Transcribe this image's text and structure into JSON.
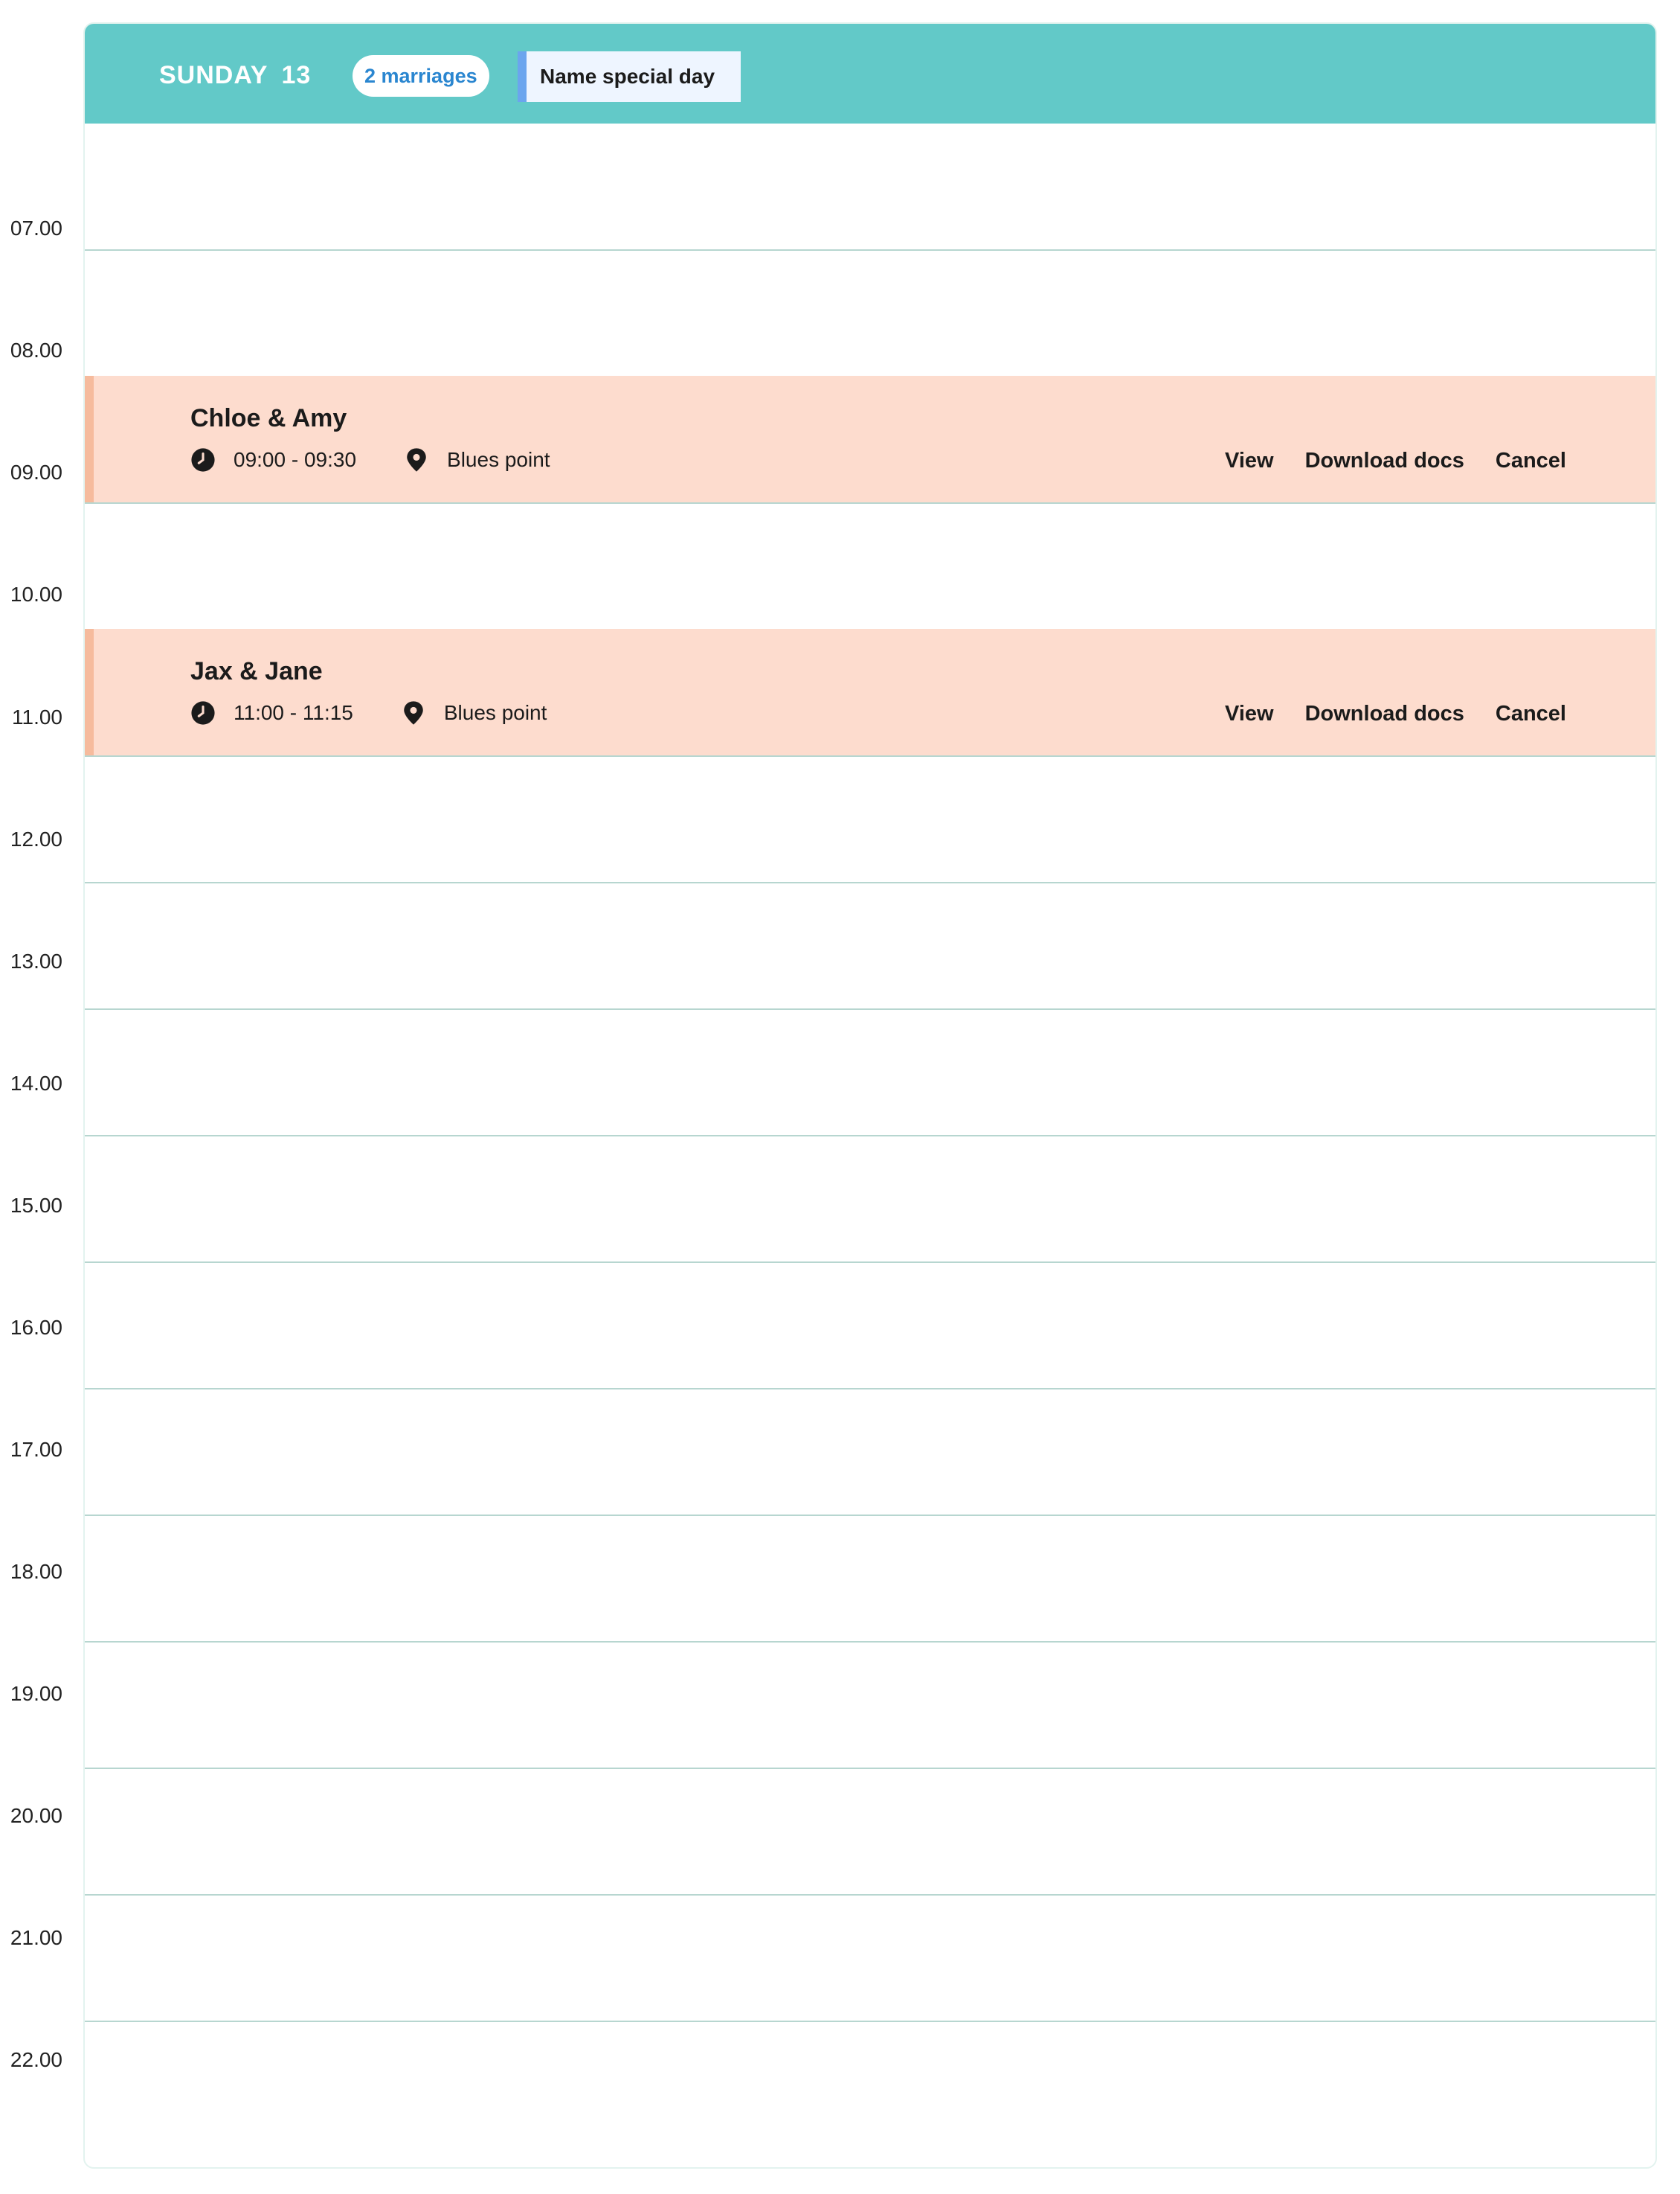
{
  "header": {
    "day": "SUNDAY",
    "date": "13",
    "marriages_badge": "2 marriages",
    "special_day_label": "Name special day"
  },
  "hours": [
    "07.00",
    "08.00",
    "09.00",
    "10.00",
    "11.00",
    "12.00",
    "13.00",
    "14.00",
    "15.00",
    "16.00",
    "17.00",
    "18.00",
    "19.00",
    "20.00",
    "21.00",
    "22.00"
  ],
  "events": [
    {
      "name": "Chloe & Amy",
      "time": "09:00 - 09:30",
      "location": "Blues point",
      "actions": {
        "view": "View",
        "download": "Download docs",
        "cancel": "Cancel"
      }
    },
    {
      "name": "Jax & Jane",
      "time": "11:00 - 11:15",
      "location": "Blues point",
      "actions": {
        "view": "View",
        "download": "Download docs",
        "cancel": "Cancel"
      }
    }
  ],
  "colors": {
    "header": "#62c9c8",
    "event_bg": "#fddcce",
    "event_accent": "#f6bb9d",
    "badge_text": "#2a86d0",
    "special_day_accent": "#6ba5ee"
  }
}
